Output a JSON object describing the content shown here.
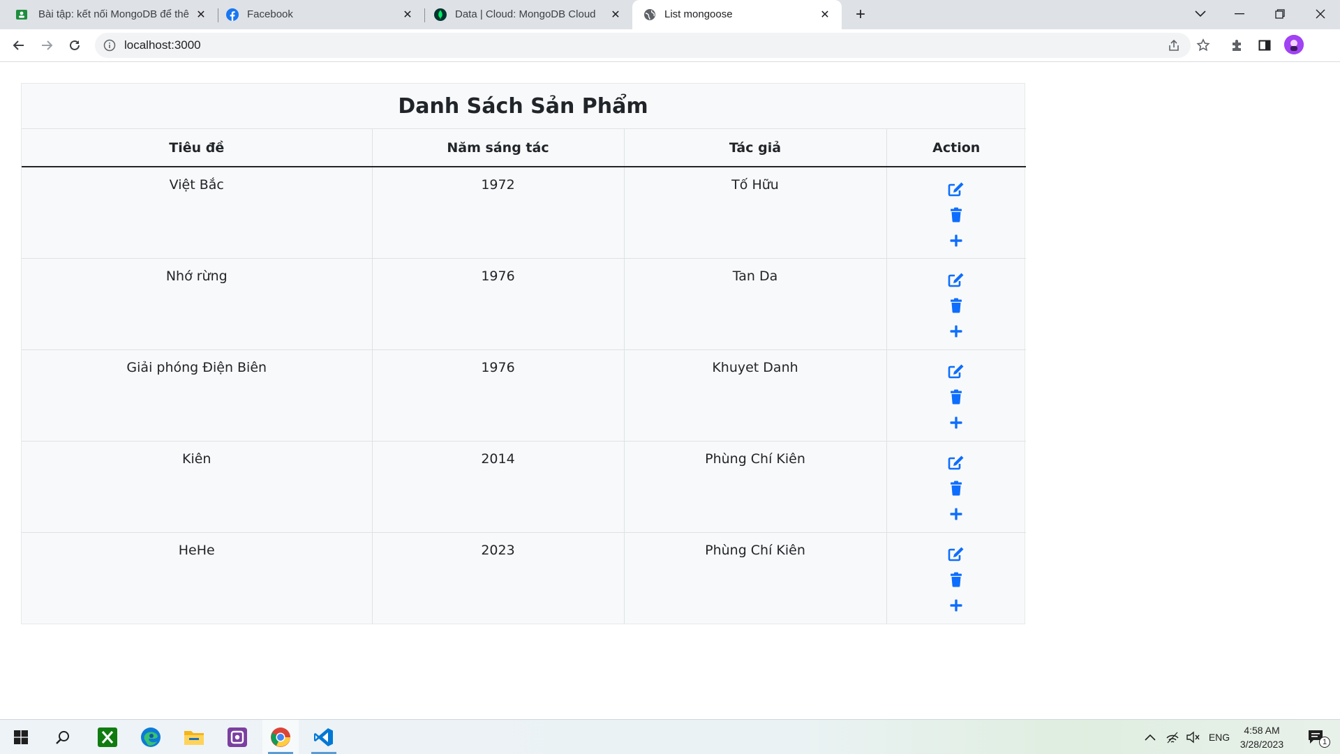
{
  "browser": {
    "tabs": [
      {
        "title": "Bài tập: kết nối MongoDB để thê",
        "active": false
      },
      {
        "title": "Facebook",
        "active": false
      },
      {
        "title": "Data | Cloud: MongoDB Cloud",
        "active": false
      },
      {
        "title": "List mongoose",
        "active": true
      }
    ],
    "url": "localhost:3000"
  },
  "page": {
    "heading": "Danh Sách Sản Phẩm",
    "columns": [
      "Tiêu đề",
      "Năm sáng tác",
      "Tác giả",
      "Action"
    ],
    "rows": [
      {
        "title": "Việt Bắc",
        "year": "1972",
        "author": "Tố Hữu"
      },
      {
        "title": "Nhớ rừng",
        "year": "1976",
        "author": "Tan Da"
      },
      {
        "title": "Giải phóng Điện Biên",
        "year": "1976",
        "author": "Khuyet Danh"
      },
      {
        "title": "Kiên",
        "year": "2014",
        "author": "Phùng Chí Kiên"
      },
      {
        "title": "HeHe",
        "year": "2023",
        "author": "Phùng Chí Kiên"
      }
    ],
    "action_icons": [
      "edit-icon",
      "trash-icon",
      "plus-icon"
    ],
    "accent_color": "#0d6efd"
  },
  "taskbar": {
    "apps": [
      "windows-start-icon",
      "search-icon",
      "xbox-icon",
      "edge-icon",
      "file-explorer-icon",
      "app-icon",
      "chrome-icon",
      "vscode-icon"
    ],
    "language": "ENG",
    "time": "4:58 AM",
    "date": "3/28/2023",
    "notification_count": "1"
  }
}
